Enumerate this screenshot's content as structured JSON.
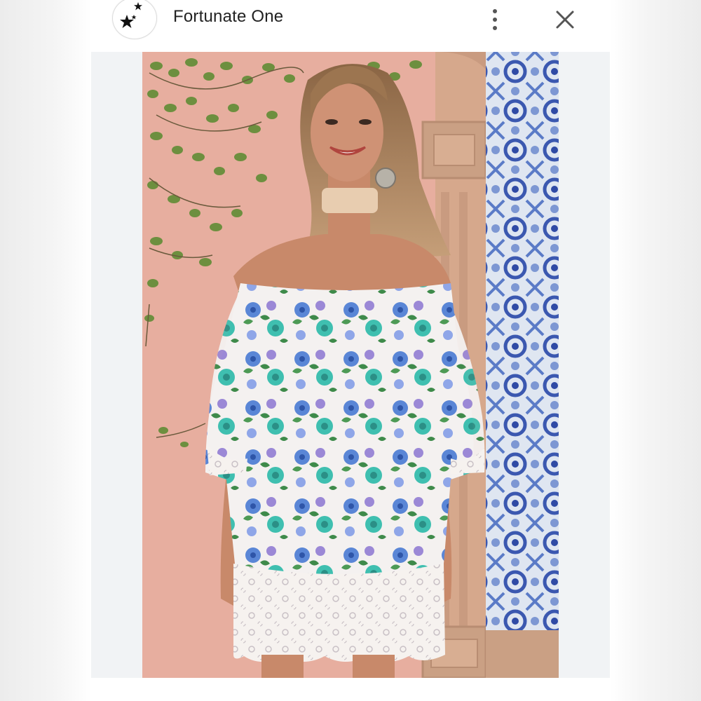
{
  "header": {
    "title": "Fortunate One",
    "avatar_icon": "stars-icon",
    "menu_icon": "more-vertical-icon",
    "close_icon": "close-icon"
  },
  "photo": {
    "subject": "woman-floral-dress-photo",
    "colors": {
      "wall": "#e9b2a3",
      "ivy": "#6d8f3f",
      "stone": "#d6a88c",
      "tile_blue": "#3b58b0",
      "dress": "#f4f1f0"
    }
  }
}
